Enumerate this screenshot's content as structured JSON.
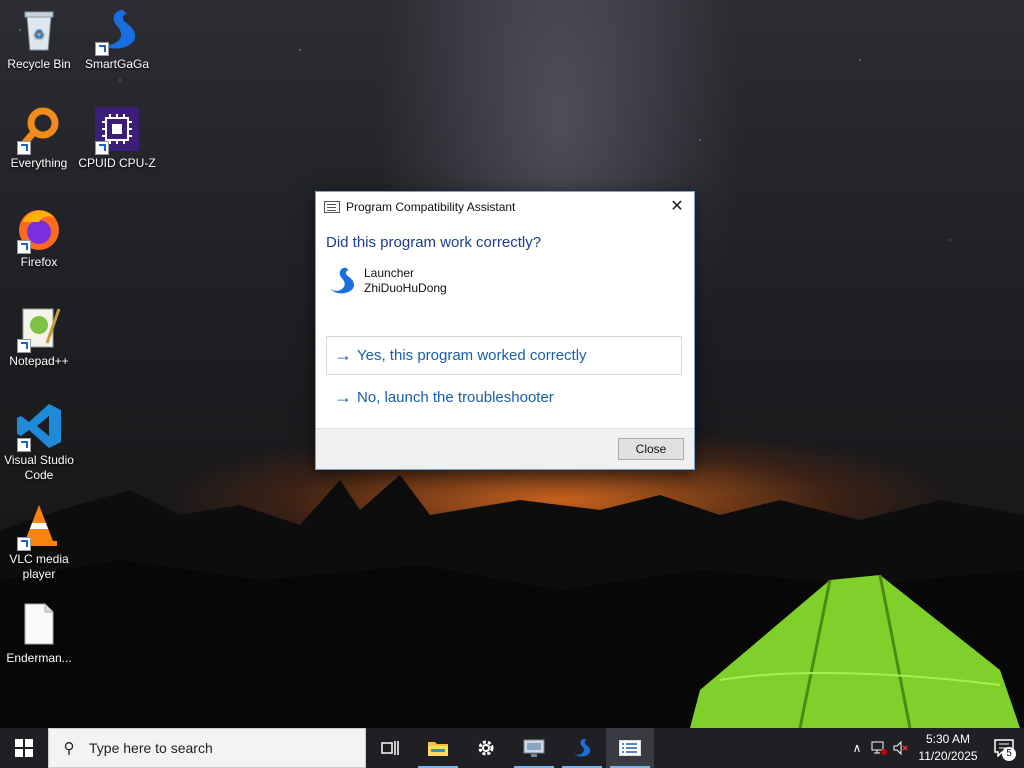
{
  "desktop": {
    "icons": [
      {
        "label": "Recycle Bin",
        "icon": "recycle-bin-icon"
      },
      {
        "label": "SmartGaGa",
        "icon": "swan-icon"
      },
      {
        "label": "Everything",
        "icon": "magnifier-orange-icon"
      },
      {
        "label": "CPUID CPU-Z",
        "icon": "cpu-chip-icon"
      },
      {
        "label": "Firefox",
        "icon": "firefox-icon"
      },
      {
        "label": "Notepad++",
        "icon": "notepad-plus-icon"
      },
      {
        "label": "Visual Studio Code",
        "icon": "vscode-icon"
      },
      {
        "label": "VLC media player",
        "icon": "vlc-cone-icon"
      },
      {
        "label": "Enderman...",
        "icon": "file-icon"
      }
    ]
  },
  "dialog": {
    "title": "Program Compatibility Assistant",
    "question": "Did this program work correctly?",
    "program_name": "Launcher",
    "program_publisher": "ZhiDuoHuDong",
    "option_yes": "Yes, this program worked correctly",
    "option_no": "No, launch the troubleshooter",
    "close_button": "Close",
    "colors": {
      "heading": "#1d3c8f",
      "link": "#1a5ea8"
    }
  },
  "taskbar": {
    "search_placeholder": "Type here to search",
    "pinned": [
      "task-view-icon",
      "file-explorer-icon",
      "settings-gear-icon",
      "remote-desktop-icon",
      "swan-icon",
      "compatibility-assistant-icon"
    ],
    "clock_time": "5:30 AM",
    "clock_date": "11/20/2025",
    "notification_count": "5"
  }
}
